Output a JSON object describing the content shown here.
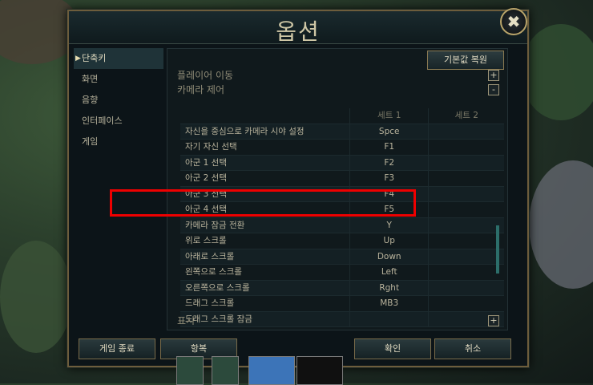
{
  "dialog": {
    "title": "옵션",
    "close_symbol": "✖",
    "restore_label": "기본값 복원"
  },
  "sidebar": {
    "items": [
      {
        "label": "단축키",
        "active": true
      },
      {
        "label": "화면"
      },
      {
        "label": "음향"
      },
      {
        "label": "인터페이스"
      },
      {
        "label": "게임"
      }
    ]
  },
  "sections": {
    "player_move": {
      "label": "플레이어 이동",
      "toggle": "+"
    },
    "camera_control": {
      "label": "카메라 제어",
      "toggle": "-"
    },
    "display": {
      "label": "표시",
      "toggle": "+"
    }
  },
  "table": {
    "headers": [
      "",
      "세트 1",
      "세트 2"
    ],
    "rows": [
      {
        "action": "자신을 중심으로 카메라 시야 설정",
        "set1": "Spce",
        "set2": ""
      },
      {
        "action": "자기 자신 선택",
        "set1": "F1",
        "set2": ""
      },
      {
        "action": "아군 1 선택",
        "set1": "F2",
        "set2": ""
      },
      {
        "action": "아군 2 선택",
        "set1": "F3",
        "set2": ""
      },
      {
        "action": "아군 3 선택",
        "set1": "F4",
        "set2": ""
      },
      {
        "action": "아군 4 선택",
        "set1": "F5",
        "set2": ""
      },
      {
        "action": "카메라 잠금 전환",
        "set1": "Y",
        "set2": ""
      },
      {
        "action": "위로 스크롤",
        "set1": "Up",
        "set2": ""
      },
      {
        "action": "아래로 스크롤",
        "set1": "Down",
        "set2": ""
      },
      {
        "action": "왼쪽으로 스크롤",
        "set1": "Left",
        "set2": ""
      },
      {
        "action": "오른쪽으로 스크롤",
        "set1": "Rght",
        "set2": ""
      },
      {
        "action": "드래그 스크롤",
        "set1": "MB3",
        "set2": ""
      },
      {
        "action": "드래그 스크롤 잠금",
        "set1": "",
        "set2": ""
      }
    ]
  },
  "footer": {
    "quit_label": "게임 종료",
    "surrender_label": "항복",
    "ok_label": "확인",
    "cancel_label": "취소"
  },
  "colors": {
    "highlight": "#e00000",
    "accent_border": "#7a6c4a"
  }
}
